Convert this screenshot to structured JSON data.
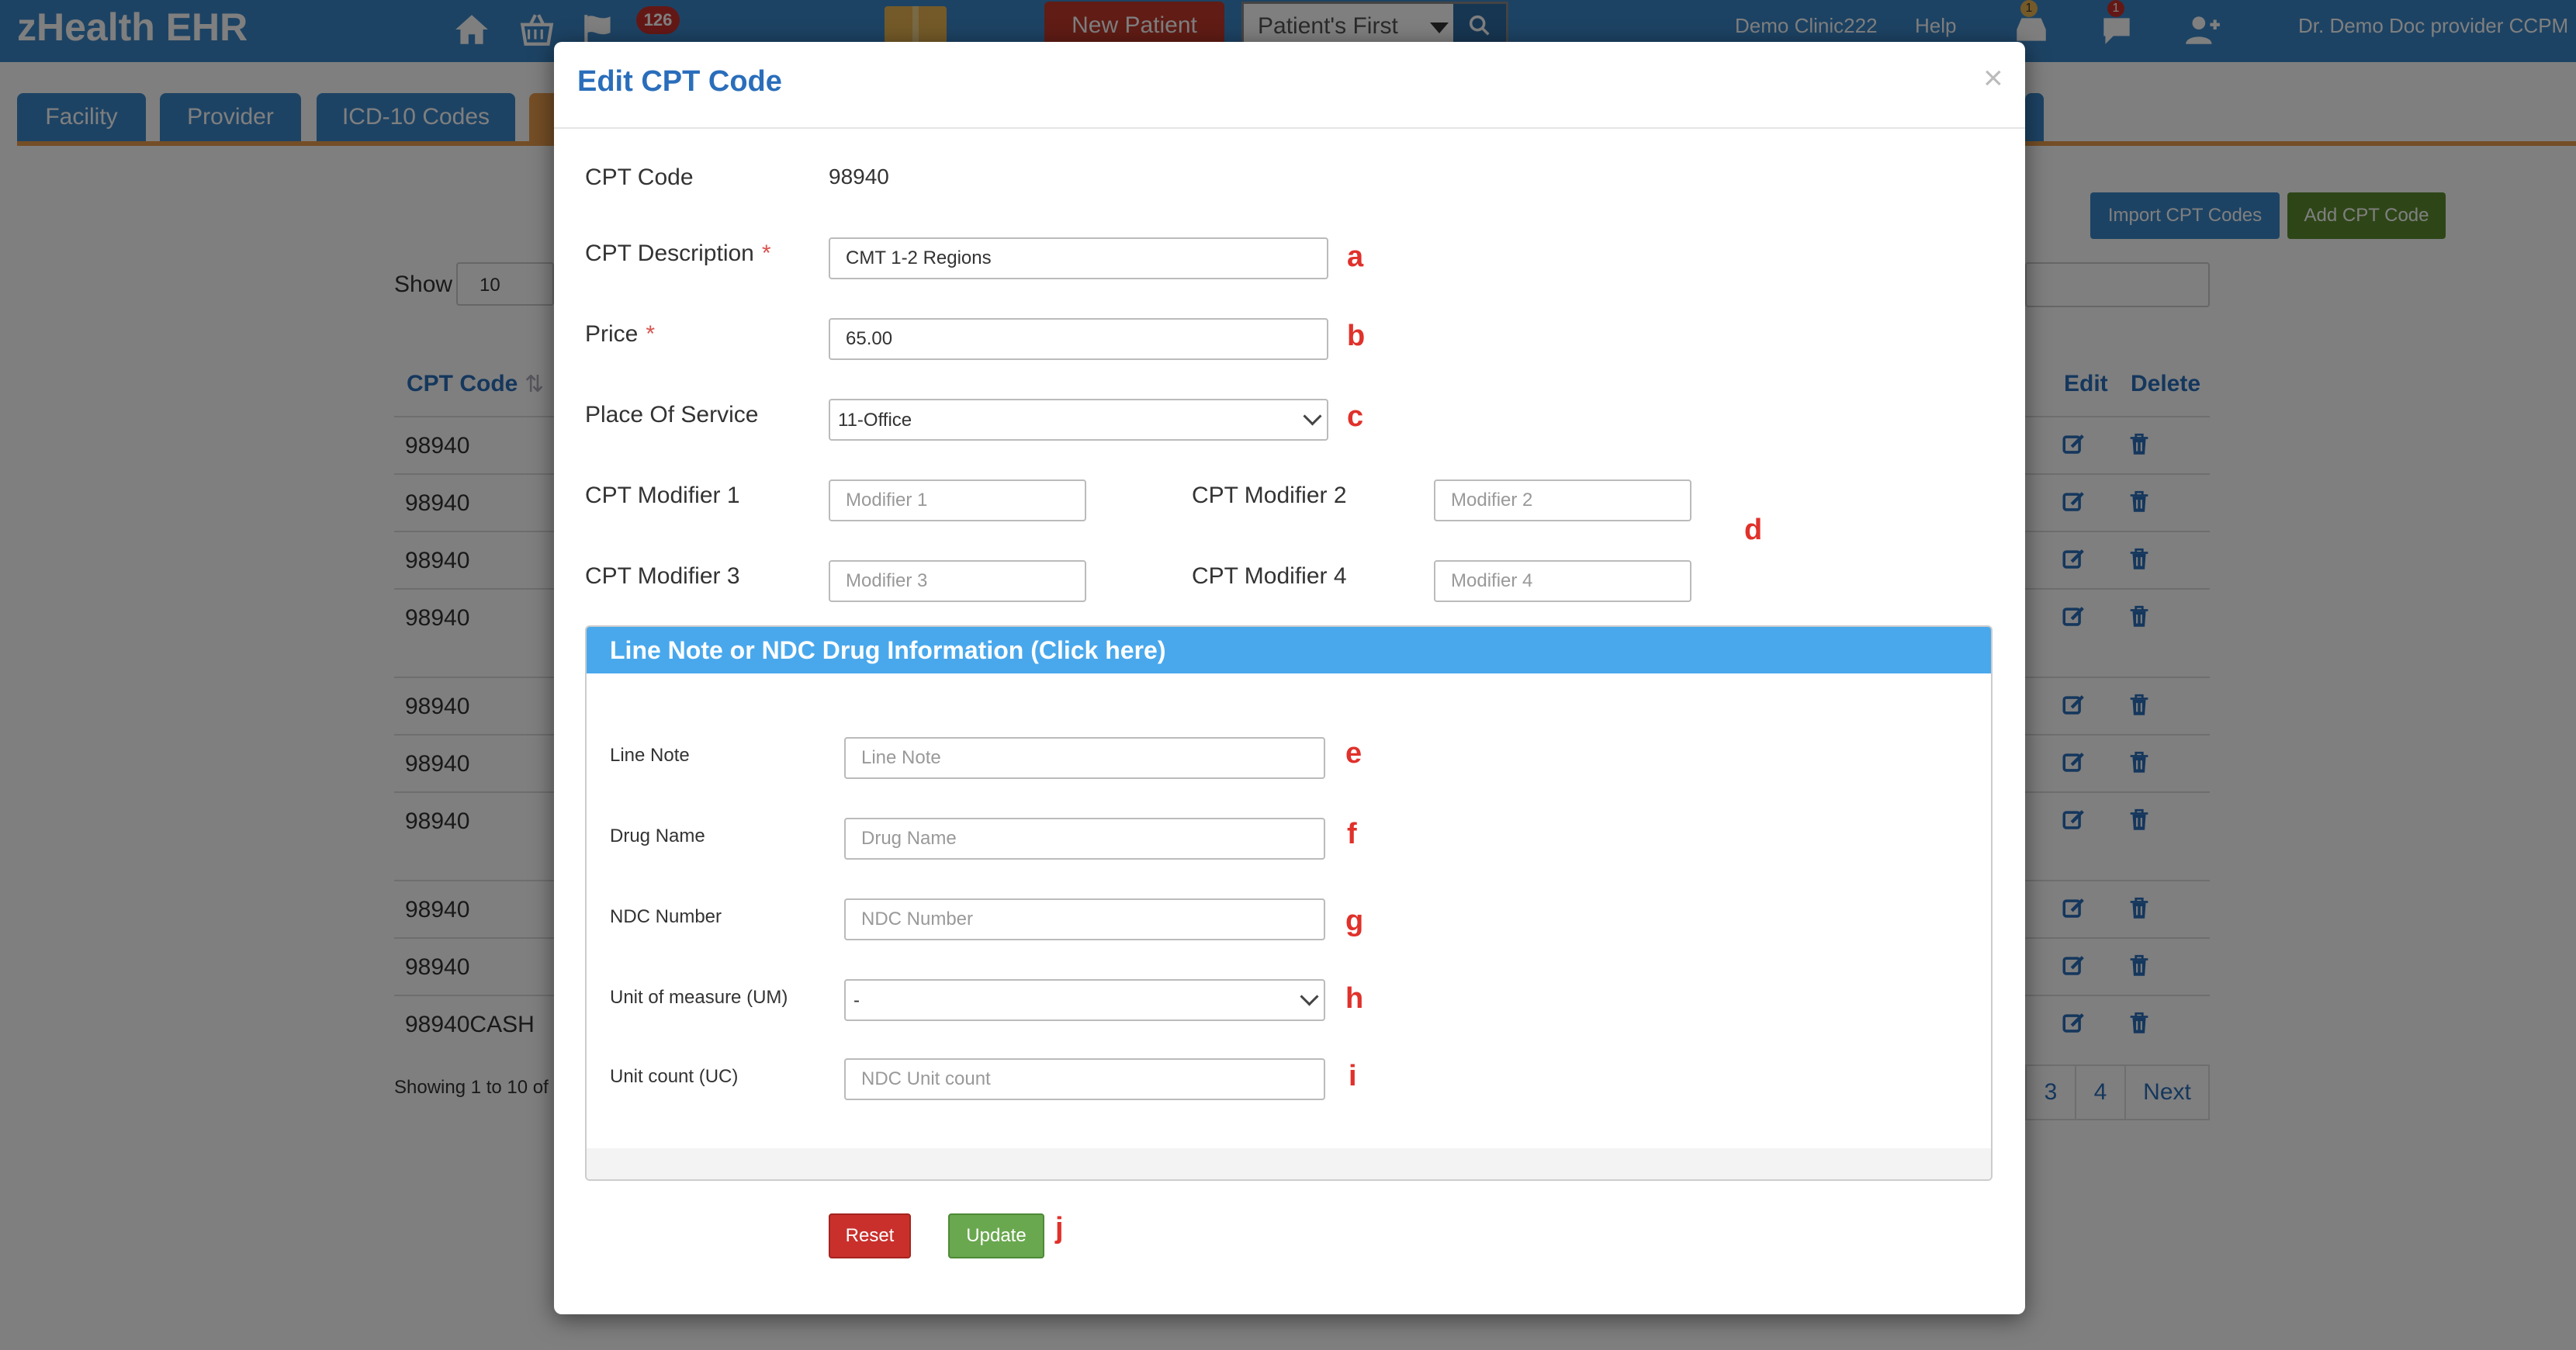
{
  "navbar": {
    "brand": "zHealth EHR",
    "notification_count": "126",
    "new_patient_label": "New Patient",
    "patient_search_selected": "Patient's First",
    "clinic": "Demo Clinic222",
    "help": "Help",
    "messages_count": "1",
    "chat_count": "1",
    "user": "Dr. Demo Doc provider CCPM"
  },
  "tabs": [
    "Facility",
    "Provider",
    "ICD-10 Codes"
  ],
  "page": {
    "import_label": "Import CPT Codes",
    "add_label": "Add CPT Code",
    "show_label": "Show",
    "show_value": "10",
    "col_cpt_code": "CPT Code",
    "col_edit": "Edit",
    "col_delete": "Delete",
    "rows": [
      "98940",
      "98940",
      "98940",
      "98940",
      "98940",
      "98940",
      "98940",
      "98940",
      "98940",
      "98940CASH"
    ],
    "showing": "Showing 1 to 10 of",
    "pages": [
      "3",
      "4"
    ],
    "next": "Next"
  },
  "modal": {
    "title": "Edit CPT Code",
    "close": "×",
    "cpt_code_label": "CPT Code",
    "cpt_code_value": "98940",
    "description_label": "CPT Description",
    "description_value": "CMT 1-2 Regions",
    "price_label": "Price",
    "price_value": "65.00",
    "required_mark": "*",
    "pos_label": "Place Of Service",
    "pos_value": "11-Office",
    "modifier1_label": "CPT Modifier 1",
    "modifier1_placeholder": "Modifier 1",
    "modifier2_label": "CPT Modifier 2",
    "modifier2_placeholder": "Modifier 2",
    "modifier3_label": "CPT Modifier 3",
    "modifier3_placeholder": "Modifier 3",
    "modifier4_label": "CPT Modifier 4",
    "modifier4_placeholder": "Modifier 4",
    "panel_title": "Line Note or NDC Drug Information (Click here)",
    "line_note_label": "Line Note",
    "line_note_placeholder": "Line Note",
    "drug_name_label": "Drug Name",
    "drug_name_placeholder": "Drug Name",
    "ndc_number_label": "NDC Number",
    "ndc_number_placeholder": "NDC Number",
    "um_label": "Unit of measure (UM)",
    "um_value": "-",
    "uc_label": "Unit count (UC)",
    "uc_placeholder": "NDC Unit count",
    "reset_label": "Reset",
    "update_label": "Update"
  },
  "annotations": [
    "a",
    "b",
    "c",
    "d",
    "e",
    "f",
    "g",
    "h",
    "i",
    "j"
  ],
  "colors": {
    "navbar": "#3a87c8",
    "title_blue": "#2a6ebb",
    "panel_header": "#49a8ec",
    "reset": "#c9302c",
    "update": "#6aa84f",
    "annotation_red": "#e0312b"
  }
}
